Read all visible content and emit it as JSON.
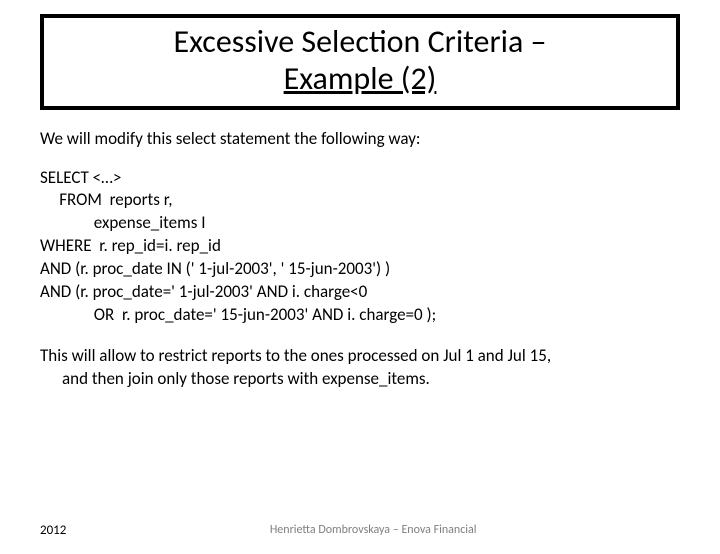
{
  "title": {
    "line1": "Excessive Selection Criteria –",
    "line2": "Example (2)"
  },
  "intro": "We will modify this select statement the following way:",
  "sql": {
    "l1": "SELECT <…>",
    "l2": "     FROM  reports r,",
    "l3": "              expense_items I",
    "l4": "WHERE  r. rep_id=i. rep_id",
    "l5": "AND (r. proc_date IN (' 1-jul-2003', ' 15-jun-2003') )",
    "l6": "AND (r. proc_date=' 1-jul-2003' AND i. charge<0",
    "l7": "              OR  r. proc_date=' 15-jun-2003' AND i. charge=0 );"
  },
  "explain": {
    "part1": "This will allow to restrict reports to the ones processed on Jul 1 and Jul 15,",
    "part2": "and then join only those reports with expense_items."
  },
  "footer": {
    "year": "2012",
    "credit": "Henrietta Dombrovskaya – Enova Financial"
  }
}
